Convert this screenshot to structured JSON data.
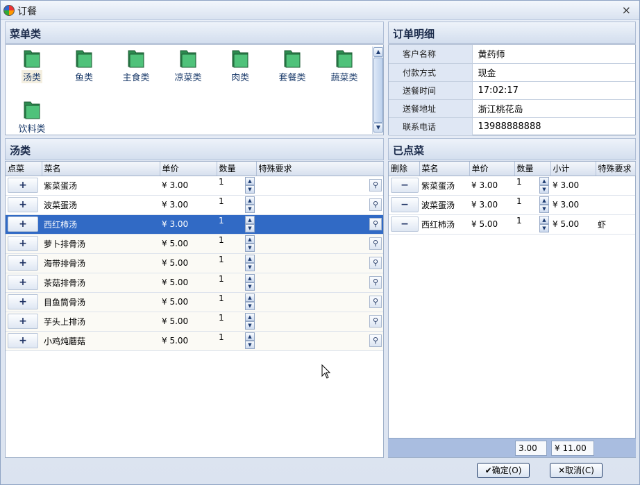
{
  "window": {
    "title": "订餐",
    "close_symbol": "×"
  },
  "categories_panel": {
    "title": "菜单类",
    "items": [
      "汤类",
      "鱼类",
      "主食类",
      "凉菜类",
      "肉类",
      "套餐类",
      "蔬菜类",
      "饮料类"
    ],
    "selected": "汤类"
  },
  "order_panel": {
    "title": "订单明细",
    "fields": [
      {
        "label": "客户名称",
        "value": "黄药师"
      },
      {
        "label": "付款方式",
        "value": "现金"
      },
      {
        "label": "送餐时间",
        "value": "17:02:17"
      },
      {
        "label": "送餐地址",
        "value": "浙江桃花岛"
      },
      {
        "label": "联系电话",
        "value": "13988888888"
      }
    ]
  },
  "dish_panel": {
    "title": "汤类",
    "columns": [
      "点菜",
      "菜名",
      "单价",
      "数量",
      "特殊要求"
    ],
    "add_symbol": "+",
    "rows": [
      {
        "name": "紫菜蛋汤",
        "price": "¥ 3.00",
        "qty": "1"
      },
      {
        "name": "波菜蛋汤",
        "price": "¥ 3.00",
        "qty": "1"
      },
      {
        "name": "西红柿汤",
        "price": "¥ 3.00",
        "qty": "1"
      },
      {
        "name": "萝卜排骨汤",
        "price": "¥ 5.00",
        "qty": "1"
      },
      {
        "name": "海带排骨汤",
        "price": "¥ 5.00",
        "qty": "1"
      },
      {
        "name": "茶菇排骨汤",
        "price": "¥ 5.00",
        "qty": "1"
      },
      {
        "name": "目鱼筒骨汤",
        "price": "¥ 5.00",
        "qty": "1"
      },
      {
        "name": "芋头上排汤",
        "price": "¥ 5.00",
        "qty": "1"
      },
      {
        "name": "小鸡炖蘑菇",
        "price": "¥ 5.00",
        "qty": "1"
      }
    ],
    "selected_row": 2
  },
  "ordered_panel": {
    "title": "已点菜",
    "columns": [
      "删除",
      "菜名",
      "单价",
      "数量",
      "小计",
      "特殊要求"
    ],
    "remove_symbol": "−",
    "rows": [
      {
        "name": "紫菜蛋汤",
        "price": "¥ 3.00",
        "qty": "1",
        "subtotal": "¥ 3.00",
        "note": ""
      },
      {
        "name": "波菜蛋汤",
        "price": "¥ 3.00",
        "qty": "1",
        "subtotal": "¥ 3.00",
        "note": ""
      },
      {
        "name": "西红柿汤",
        "price": "¥ 5.00",
        "qty": "1",
        "subtotal": "¥ 5.00",
        "note": "虾"
      }
    ],
    "totals": {
      "qty": "3.00",
      "amount": "¥ 11.00"
    }
  },
  "buttons": {
    "ok": "确定(O)",
    "cancel": "取消(C)"
  },
  "icons": {
    "app": "app-icon",
    "close": "close-icon",
    "folder": "folder-icon",
    "binoculars": "binoculars-icon",
    "spinner": "spinner-icon",
    "cursor": "mouse-cursor-icon"
  },
  "colors": {
    "selection": "#316ac5",
    "folder": "#4fc27a",
    "header": "#d3deee",
    "totals_bar": "#a9bde0"
  }
}
